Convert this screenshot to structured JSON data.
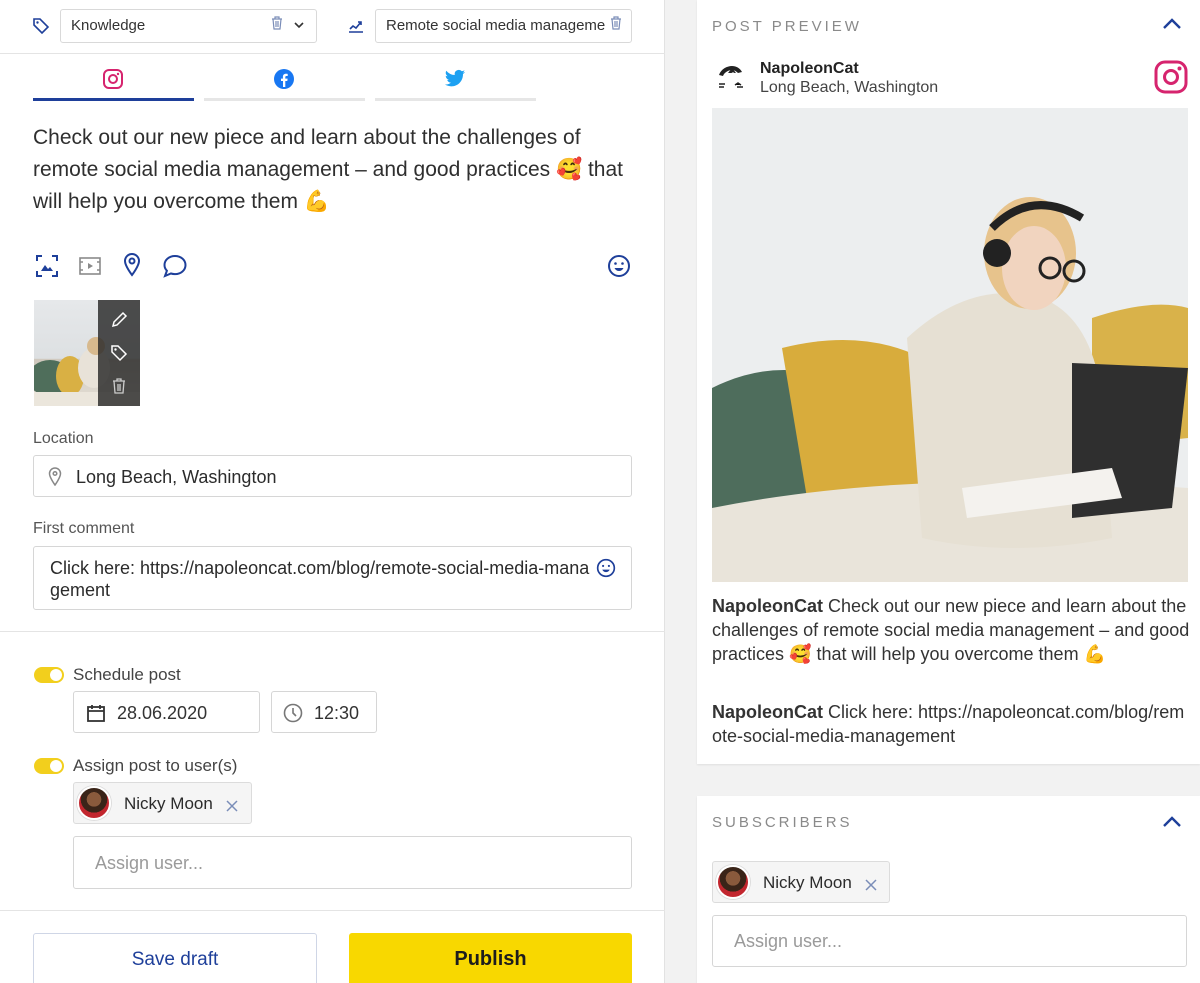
{
  "editor": {
    "labels_select": "Knowledge",
    "campaign_select": "Remote social media manageme",
    "tabs": [
      {
        "name": "instagram",
        "icon": "instagram-icon",
        "active": true
      },
      {
        "name": "facebook",
        "icon": "facebook-icon",
        "active": false
      },
      {
        "name": "twitter",
        "icon": "twitter-icon",
        "active": false
      }
    ],
    "post_text_1": "Check out our new piece and learn about the challenges of remote social media management – and good practices ",
    "post_emoji_1": "🥰",
    "post_text_2": " that will help you overcome them ",
    "post_emoji_2": "💪",
    "toolbar_icons": [
      "image-crop-icon",
      "video-icon",
      "location-pin-icon",
      "comment-icon",
      "emoji-icon"
    ],
    "thumbnail_actions": [
      "pencil-icon",
      "tag-icon",
      "trash-icon"
    ],
    "location_label": "Location",
    "location_value": "Long Beach, Washington",
    "first_comment_label": "First comment",
    "first_comment_value": "Click here: https://napoleoncat.com/blog/remote-social-media-management",
    "schedule_label": "Schedule post",
    "schedule_enabled": true,
    "schedule_date": "28.06.2020",
    "schedule_time": "12:30",
    "assign_label": "Assign post to user(s)",
    "assign_enabled": true,
    "assigned_user": "Nicky Moon",
    "assign_placeholder": "Assign user...",
    "save_draft_label": "Save draft",
    "publish_label": "Publish"
  },
  "preview": {
    "section_title": "POST PREVIEW",
    "account_name": "NapoleonCat",
    "account_location": "Long Beach, Washington",
    "caption_author": "NapoleonCat",
    "caption_text": " Check out our new piece and learn about the challenges of remote social media management – and good practices 🥰 that will help you overcome them 💪",
    "comment_author": "NapoleonCat",
    "comment_text": " Click here: https://napoleoncat.com/blog/remote-social-media-management"
  },
  "subscribers": {
    "section_title": "SUBSCRIBERS",
    "user": "Nicky Moon",
    "assign_placeholder": "Assign user..."
  },
  "colors": {
    "accent_blue": "#1e3f9a",
    "publish_yellow": "#f8d800",
    "toggle_yellow": "#f2cf1d",
    "instagram_pink": "#d6246e",
    "facebook_blue": "#1877f2",
    "twitter_blue": "#1da1f2"
  }
}
